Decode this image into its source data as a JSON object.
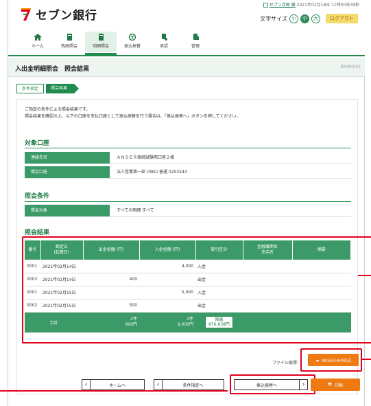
{
  "brand": {
    "name": "セブン銀行",
    "accent": "#1f8b4c",
    "logo_color": "#e0001b"
  },
  "user": {
    "name": "セブン次郎 様",
    "last_login": "2021年02月18日 11時00分39秒"
  },
  "font_size": {
    "label": "文字サイズ",
    "small": "小",
    "medium": "中",
    "large": "大",
    "selected": "中"
  },
  "logout_label": "ログアウト",
  "nav": [
    {
      "label": "ホーム",
      "icon": "home-icon"
    },
    {
      "label": "残高照会",
      "icon": "document-icon"
    },
    {
      "label": "明細照会",
      "icon": "document-icon",
      "active": true
    },
    {
      "label": "振込振替",
      "icon": "transfer-icon"
    },
    {
      "label": "承認",
      "icon": "approve-icon"
    },
    {
      "label": "管理",
      "icon": "admin-icon"
    }
  ],
  "page": {
    "title": "入出金明細照会　照会結果",
    "code": "BNMR002"
  },
  "steps": [
    "条件指定",
    "照会結果"
  ],
  "message": [
    "ご指定の条件による照会結果です。",
    "照会結果を確認の上、以下の口座を支払口座として振込振替を行う場合は、「振込振替へ」ボタンを押してください。"
  ],
  "account": {
    "heading": "対象口座",
    "rows": [
      {
        "label": "連絡先名",
        "value": "ＡＮＳＥＲ接続試験用口座２様"
      },
      {
        "label": "照会口座",
        "value": "法人営業第一部 (081)  普通 0253244"
      }
    ]
  },
  "condition": {
    "heading": "照会条件",
    "rows": [
      {
        "label": "照会対象",
        "value": "すべての明細  すべて"
      }
    ]
  },
  "result": {
    "heading": "照会結果",
    "columns": [
      "番号",
      "勘定日\n(起算日)",
      "出金金額 (円)",
      "入金金額 (円)",
      "取引区分",
      "金融機関名\n支店名",
      "摘要"
    ],
    "rows": [
      {
        "no": "0001",
        "date": "2021年02月14日",
        "out": "",
        "in": "4,000",
        "type": "入金",
        "bank": "",
        "memo": ""
      },
      {
        "no": "0002",
        "date": "2021年02月14日",
        "out": "400",
        "in": "",
        "type": "出金",
        "bank": "",
        "memo": ""
      },
      {
        "no": "0001",
        "date": "2021年02月15日",
        "out": "",
        "in": "5,000",
        "type": "入金",
        "bank": "",
        "memo": ""
      },
      {
        "no": "0002",
        "date": "2021年02月15日",
        "out": "500",
        "in": "",
        "type": "出金",
        "bank": "",
        "memo": ""
      }
    ],
    "total": {
      "label": "合計",
      "out_count": "2件",
      "out_amount": "900円",
      "in_count": "2件",
      "in_amount": "9,000円",
      "balance_label": "残高",
      "balance": "876,638円"
    }
  },
  "file": {
    "label": "ファイル取得：",
    "anser_button": "ANSER-API形式"
  },
  "buttons": {
    "home": "ホームへ",
    "condition": "条件指定へ",
    "transfer": "振込振替へ",
    "print": "印刷"
  }
}
